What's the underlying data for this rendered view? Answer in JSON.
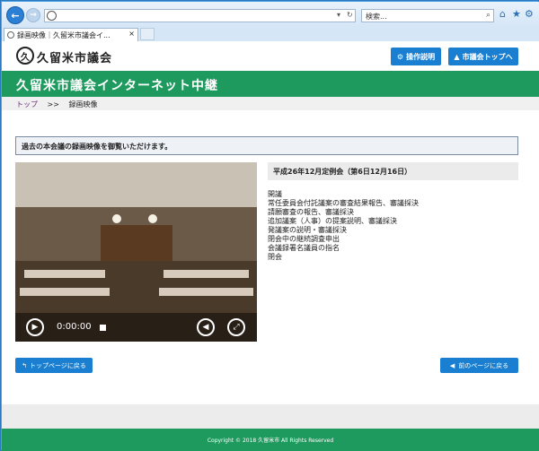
{
  "browser": {
    "search_placeholder": "検索...",
    "tab_title": "録画映像｜久留米市議会イ...",
    "tab_close": "×"
  },
  "site": {
    "logo_mark": "久",
    "name": "久留米市議会",
    "help_button": "操作説明",
    "top_button": "市議会トップへ",
    "banner": "久留米市議会インターネット中継"
  },
  "breadcrumb": {
    "home": "トップ",
    "separator": ">>",
    "current": "録画映像"
  },
  "notice": "過去の本会議の録画映像を御覧いただけます。",
  "player": {
    "time": "0:00:00"
  },
  "session_title": "平成26年12月定例会（第6日12月16日）",
  "agenda": [
    "開議",
    "常任委員会付託議案の審査結果報告、審議採決",
    "請願審査の報告、審議採決",
    "追加議案（人事）の提案説明、審議採決",
    "発議案の説明・審議採決",
    "閉会中の継続調査申出",
    "会議録署名議員の指名",
    "閉会"
  ],
  "buttons": {
    "home": "トップページに戻る",
    "back": "前のページに戻る"
  },
  "footer": "Copyright © 2018 久留米市 All Rights Reserved",
  "colors": {
    "brand_green": "#1e9a5e",
    "button_blue": "#1a7fd0"
  }
}
